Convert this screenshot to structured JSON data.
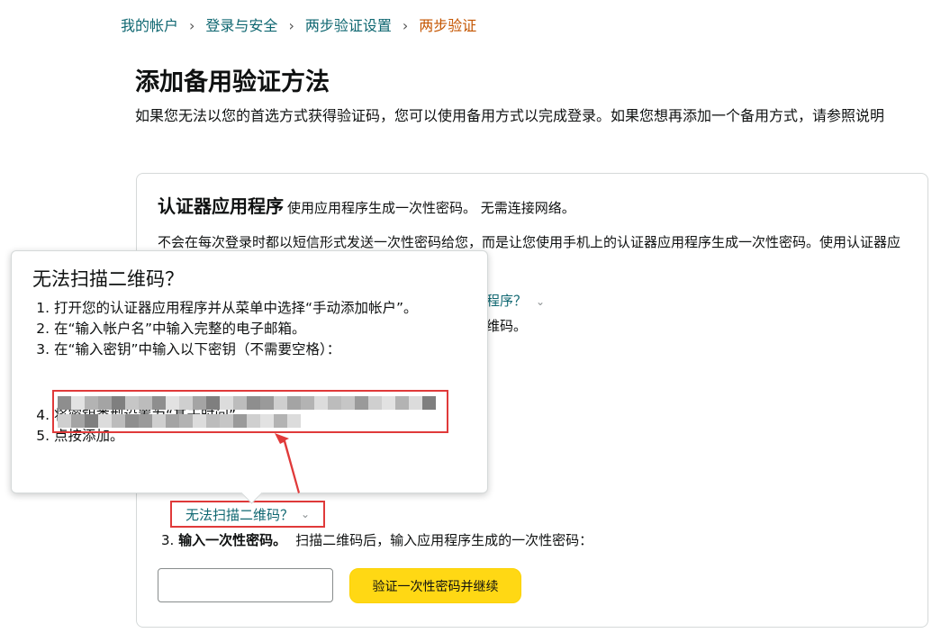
{
  "breadcrumb": {
    "items": [
      "我的帐户",
      "登录与安全",
      "两步验证设置"
    ],
    "current": "两步验证",
    "separator": "›"
  },
  "page": {
    "title": "添加备用验证方法",
    "intro": "如果您无法以您的首选方式获得验证码，您可以使用备用方式以完成登录。如果您想再添加一个备用方式，请参照说明"
  },
  "card": {
    "heading": "认证器应用程序",
    "subheading": "使用应用程序生成一次性密码。 无需连接网络。",
    "description": "不会在每次登录时都以短信形式发送一次性密码给您，而是让您使用手机上的认证器应用程序生成一次性密码。使用认证器应用程序的登录方式与使用短信接收一次性密码相同。",
    "partial_link": "程序？",
    "partial_text": "维码。",
    "scan_link": "无法扫描二维码？",
    "step3_num": "3.",
    "step3_bold": "输入一次性密码。",
    "step3_text": "扫描二维码后，输入应用程序生成的一次性密码：",
    "otp_input_value": "",
    "verify_button": "验证一次性密码并继续"
  },
  "popover": {
    "title": "无法扫描二维码？",
    "steps": [
      "打开您的认证器应用程序并从菜单中选择“手动添加帐户”。",
      "在“输入帐户名”中输入完整的电子邮箱。",
      "在“输入密钥”中输入以下密钥（不需要空格）：",
      "将密钥类型设置为“基于时间”",
      "点按添加。"
    ]
  },
  "icons": {
    "chevron": "chevron-down-icon",
    "arrow": "annotation-arrow-icon"
  },
  "colors": {
    "link": "#0f6771",
    "current": "#c45500",
    "button": "#ffd814",
    "annotation": "#e03a3a"
  }
}
